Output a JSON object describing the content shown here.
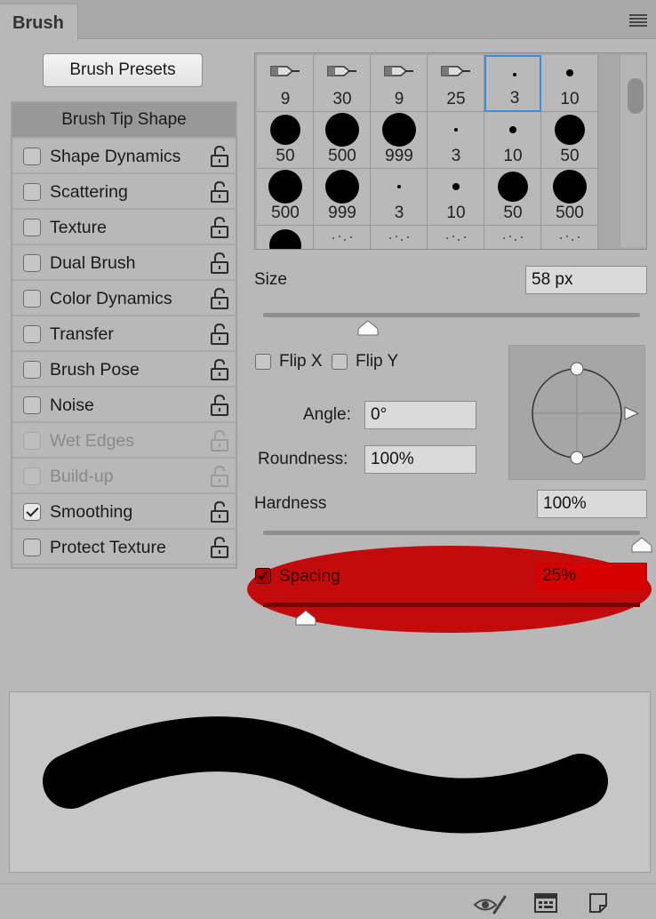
{
  "panel": {
    "tab_title": "Brush"
  },
  "presets_button": "Brush Presets",
  "options": {
    "header": "Brush Tip Shape",
    "items": [
      {
        "label": "Shape Dynamics",
        "checked": false,
        "disabled": false
      },
      {
        "label": "Scattering",
        "checked": false,
        "disabled": false
      },
      {
        "label": "Texture",
        "checked": false,
        "disabled": false
      },
      {
        "label": "Dual Brush",
        "checked": false,
        "disabled": false
      },
      {
        "label": "Color Dynamics",
        "checked": false,
        "disabled": false
      },
      {
        "label": "Transfer",
        "checked": false,
        "disabled": false
      },
      {
        "label": "Brush Pose",
        "checked": false,
        "disabled": false
      },
      {
        "label": "Noise",
        "checked": false,
        "disabled": false
      },
      {
        "label": "Wet Edges",
        "checked": false,
        "disabled": true
      },
      {
        "label": "Build-up",
        "checked": false,
        "disabled": true
      },
      {
        "label": "Smoothing",
        "checked": true,
        "disabled": false
      },
      {
        "label": "Protect Texture",
        "checked": false,
        "disabled": false
      }
    ]
  },
  "brush_grid": {
    "rows": [
      [
        "9",
        "30",
        "9",
        "25",
        "3",
        "10"
      ],
      [
        "50",
        "500",
        "999",
        "3",
        "10",
        "50"
      ],
      [
        "500",
        "999",
        "3",
        "10",
        "50",
        "500"
      ]
    ],
    "selected": "3"
  },
  "size": {
    "label": "Size",
    "value": "58 px"
  },
  "flip": {
    "x_label": "Flip X",
    "y_label": "Flip Y"
  },
  "angle": {
    "label": "Angle:",
    "value": "0°"
  },
  "roundness": {
    "label": "Roundness:",
    "value": "100%"
  },
  "hardness": {
    "label": "Hardness",
    "value": "100%"
  },
  "spacing": {
    "label": "Spacing",
    "value": "25%",
    "checked": true
  },
  "colors": {
    "panel_bg": "#b8b8b8",
    "highlight": "#c40000",
    "selection": "#3d8ee0"
  },
  "bottom_icons": [
    "eye-brush-icon",
    "grid-panel-icon",
    "new-page-icon"
  ]
}
